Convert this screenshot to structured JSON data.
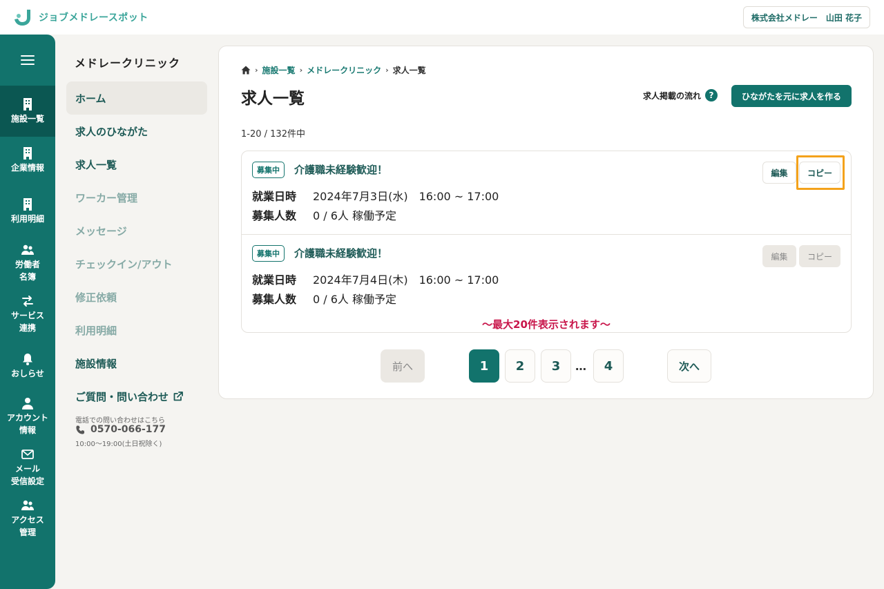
{
  "header": {
    "logo_text": "ジョブメドレースポット",
    "user_label": "株式会社メドレー　山田 花子",
    "brand_color": "#12736c"
  },
  "rail": {
    "menu_icon": "hamburger-icon",
    "items": [
      {
        "label": "施設一覧",
        "icon": "building-icon",
        "active": true
      },
      {
        "label": "企業情報",
        "icon": "building-icon"
      },
      {
        "label": "利用明細",
        "icon": "building-icon"
      },
      {
        "label_1": "労働者",
        "label_2": "名簿",
        "icon": "users-icon"
      },
      {
        "label_1": "サービス",
        "label_2": "連携",
        "icon": "swap-icon"
      },
      {
        "label": "おしらせ",
        "icon": "bell-icon"
      },
      {
        "label_1": "アカウント",
        "label_2": "情報",
        "icon": "user-icon"
      },
      {
        "label_1": "メール",
        "label_2": "受信設定",
        "icon": "mail-icon"
      },
      {
        "label_1": "アクセス",
        "label_2": "管理",
        "icon": "users-icon"
      }
    ]
  },
  "subnav": {
    "title": "メドレークリニック",
    "items": [
      {
        "label": "ホーム",
        "state": "active"
      },
      {
        "label": "求人のひながた",
        "state": "enabled"
      },
      {
        "label": "求人一覧",
        "state": "enabled"
      },
      {
        "label": "ワーカー管理",
        "state": "dim"
      },
      {
        "label": "メッセージ",
        "state": "dim"
      },
      {
        "label": "チェックイン/アウト",
        "state": "dim"
      },
      {
        "label": "修正依頼",
        "state": "dim"
      },
      {
        "label": "利用明細",
        "state": "dim"
      },
      {
        "label": "施設情報",
        "state": "enabled"
      },
      {
        "label": "ご質問・問い合わせ",
        "state": "enabled",
        "icon": "external-link-icon"
      }
    ],
    "contact_note": "電話での問い合わせはこちら",
    "contact_phone": "0570-066-177",
    "contact_hours": "10:00〜19:00(土日祝除く)"
  },
  "main": {
    "breadcrumb": {
      "home_icon": "home-icon",
      "items": [
        "施設一覧",
        "メドレークリニック",
        "求人一覧"
      ]
    },
    "page_title": "求人一覧",
    "flow_link": "求人掲載の流れ",
    "help_icon_glyph": "?",
    "create_button": "ひながたを元に求人を作る",
    "count_text": "1-20 / 132件中",
    "jobs": [
      {
        "badge": "募集中",
        "title": "介護職未経験歓迎！",
        "date_label": "就業日時",
        "date_value": "2024年7月3日(水)　16:00 ~ 17:00",
        "recruit_label": "募集人数",
        "recruit_value": "0 / 6人 稼働予定",
        "edit_label": "編集",
        "copy_label": "コピー",
        "actions_enabled": true
      },
      {
        "badge": "募集中",
        "title": "介護職未経験歓迎！",
        "date_label": "就業日時",
        "date_value": "2024年7月4日(木)　16:00 ~ 17:00",
        "recruit_label": "募集人数",
        "recruit_value": "0 / 6人 稼働予定",
        "edit_label": "編集",
        "copy_label": "コピー",
        "actions_enabled": false
      }
    ],
    "max_note": "〜最大20件表示されます〜",
    "pagination": {
      "prev": "前へ",
      "pages": [
        "1",
        "2",
        "3",
        "4"
      ],
      "current": "1",
      "ellipsis": "…",
      "next": "次へ"
    }
  }
}
